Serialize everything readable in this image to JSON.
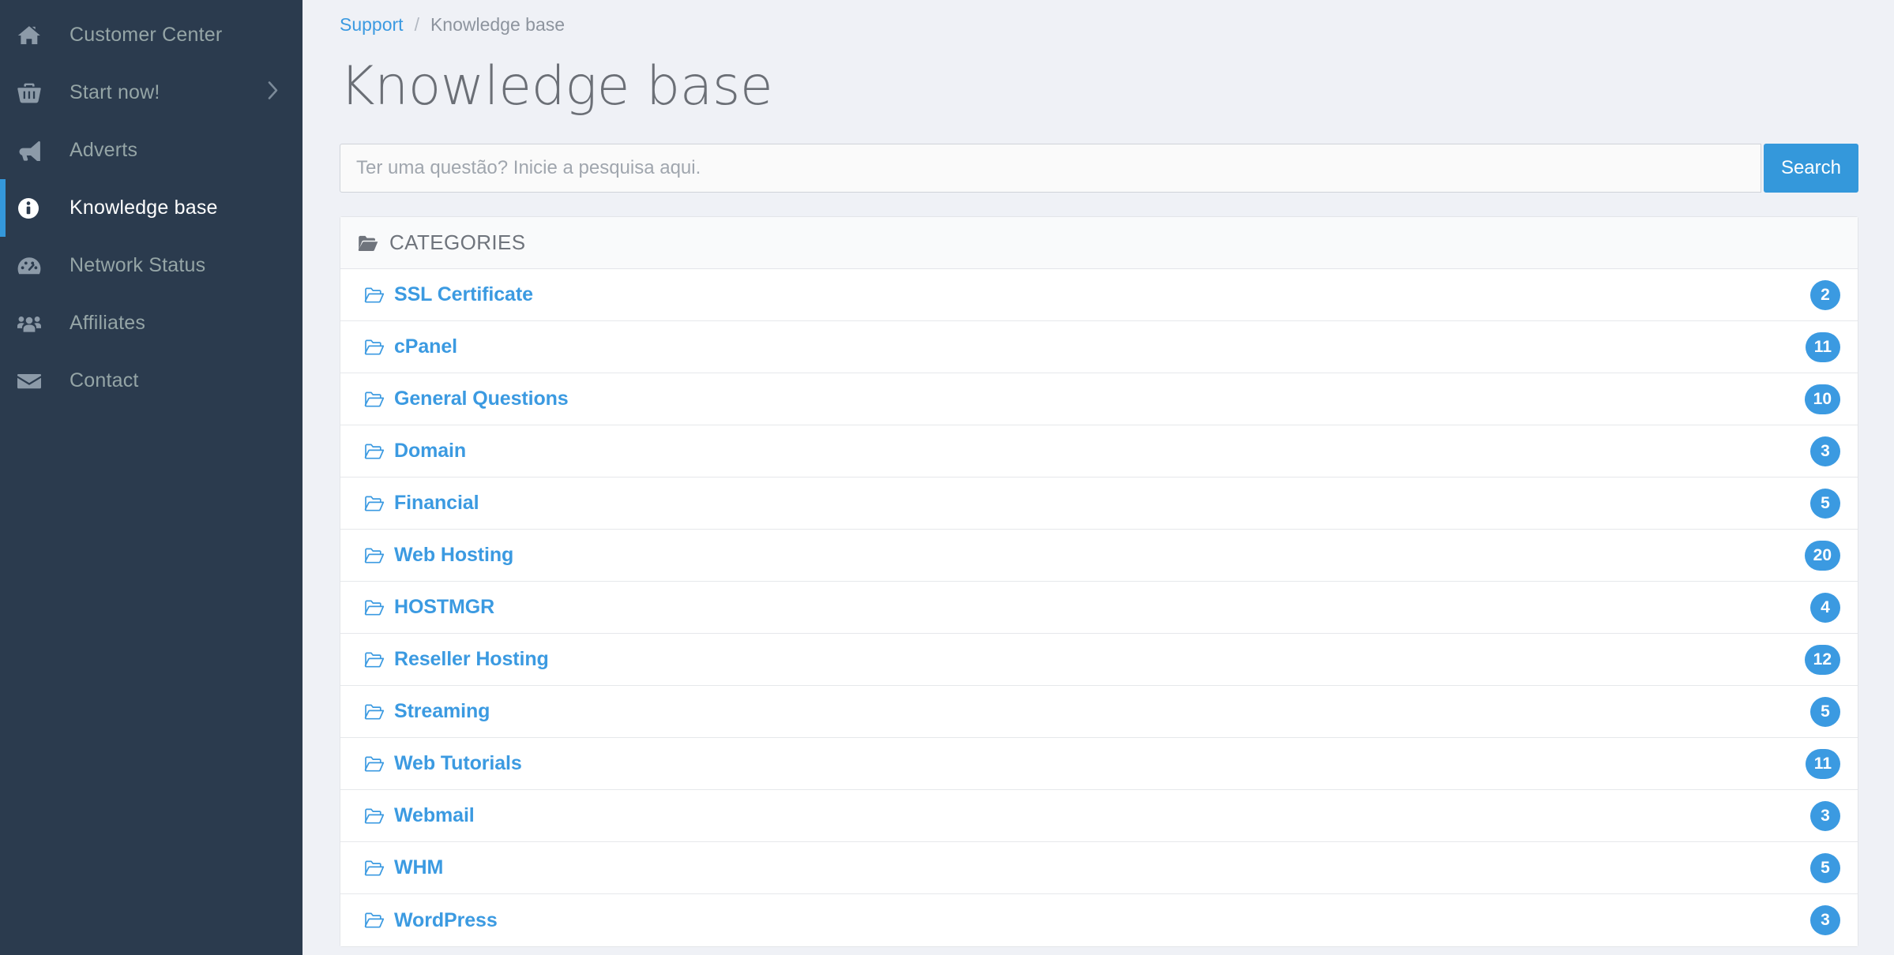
{
  "sidebar": {
    "items": [
      {
        "label": "Customer Center",
        "icon": "home-icon",
        "active": false,
        "caret": false
      },
      {
        "label": "Start now!",
        "icon": "basket-icon",
        "active": false,
        "caret": true
      },
      {
        "label": "Adverts",
        "icon": "bullhorn-icon",
        "active": false,
        "caret": false
      },
      {
        "label": "Knowledge base",
        "icon": "info-circle-icon",
        "active": true,
        "caret": false
      },
      {
        "label": "Network Status",
        "icon": "dashboard-icon",
        "active": false,
        "caret": false
      },
      {
        "label": "Affiliates",
        "icon": "users-icon",
        "active": false,
        "caret": false
      },
      {
        "label": "Contact",
        "icon": "envelope-icon",
        "active": false,
        "caret": false
      }
    ]
  },
  "breadcrumb": {
    "link": "Support",
    "separator": "/",
    "current": "Knowledge base"
  },
  "header": {
    "title": "Knowledge base"
  },
  "search": {
    "placeholder": "Ter uma questão? Inicie a pesquisa aqui.",
    "value": "",
    "button_label": "Search"
  },
  "panel": {
    "heading": "CATEGORIES",
    "heading_icon": "folder-icon",
    "categories": [
      {
        "name": "SSL Certificate",
        "count": "2",
        "icon": "folder-open-icon"
      },
      {
        "name": "cPanel",
        "count": "11",
        "icon": "folder-open-icon"
      },
      {
        "name": "General Questions",
        "count": "10",
        "icon": "folder-open-icon"
      },
      {
        "name": "Domain",
        "count": "3",
        "icon": "folder-open-icon"
      },
      {
        "name": "Financial",
        "count": "5",
        "icon": "folder-open-icon"
      },
      {
        "name": "Web Hosting",
        "count": "20",
        "icon": "folder-open-icon"
      },
      {
        "name": "HOSTMGR",
        "count": "4",
        "icon": "folder-open-icon"
      },
      {
        "name": "Reseller Hosting",
        "count": "12",
        "icon": "folder-open-icon"
      },
      {
        "name": "Streaming",
        "count": "5",
        "icon": "folder-open-icon"
      },
      {
        "name": "Web Tutorials",
        "count": "11",
        "icon": "folder-open-icon"
      },
      {
        "name": "Webmail",
        "count": "3",
        "icon": "folder-open-icon"
      },
      {
        "name": "WHM",
        "count": "5",
        "icon": "folder-open-icon"
      },
      {
        "name": "WordPress",
        "count": "3",
        "icon": "folder-open-icon"
      }
    ]
  },
  "colors": {
    "sidebar_bg": "#2b3b4e",
    "accent": "#3498db",
    "link": "#3b9ae1",
    "page_bg": "#eff1f6",
    "muted_text": "#95a5a6"
  }
}
